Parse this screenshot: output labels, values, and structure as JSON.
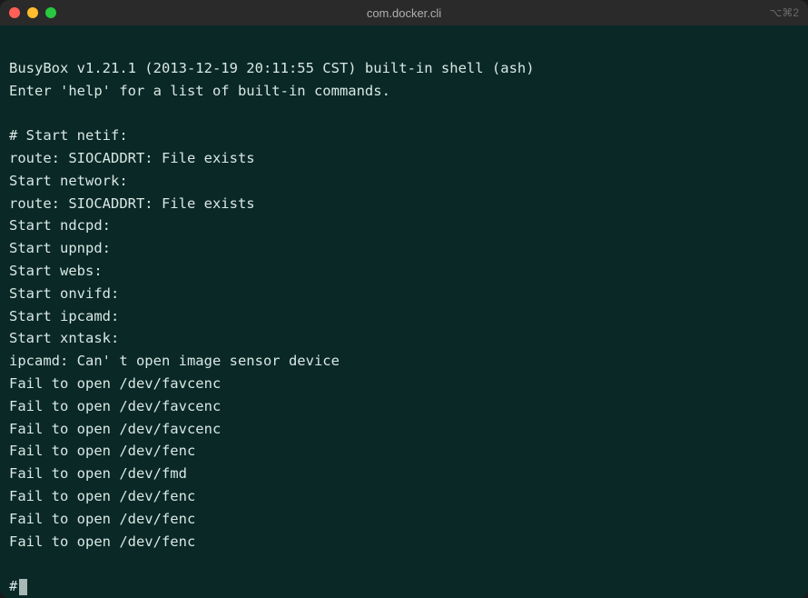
{
  "window": {
    "title": "com.docker.cli",
    "shortcut": "⌥⌘2"
  },
  "terminal": {
    "lines": [
      "",
      "BusyBox v1.21.1 (2013-12-19 20:11:55 CST) built-in shell (ash)",
      "Enter 'help' for a list of built-in commands.",
      "",
      "# Start netif:",
      "route: SIOCADDRT: File exists",
      "Start network:",
      "route: SIOCADDRT: File exists",
      "Start ndcpd:",
      "Start upnpd:",
      "Start webs:",
      "Start onvifd:",
      "Start ipcamd:",
      "Start xntask:",
      "ipcamd: Can' t open image sensor device",
      "Fail to open /dev/favcenc",
      "Fail to open /dev/favcenc",
      "Fail to open /dev/favcenc",
      "Fail to open /dev/fenc",
      "Fail to open /dev/fmd",
      "Fail to open /dev/fenc",
      "Fail to open /dev/fenc",
      "Fail to open /dev/fenc"
    ],
    "prompt": "# "
  }
}
